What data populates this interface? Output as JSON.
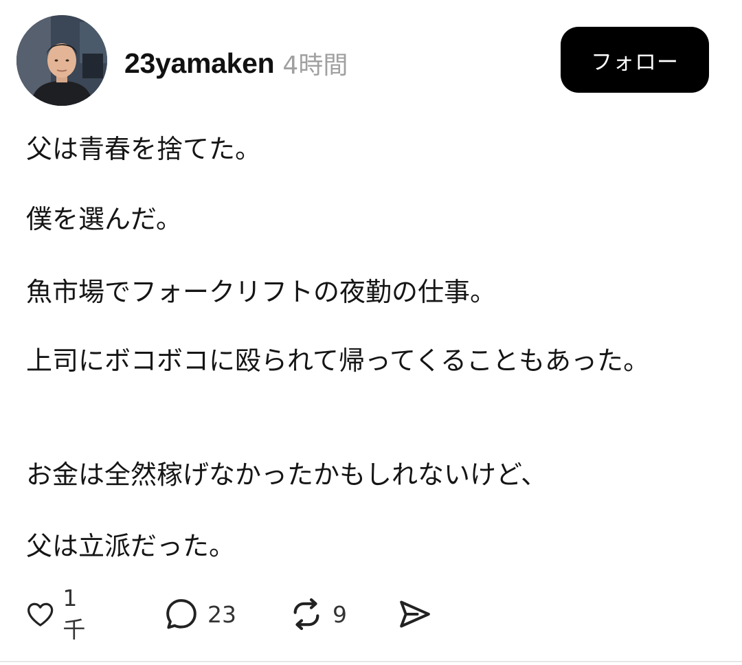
{
  "post": {
    "author": {
      "username": "23yamaken",
      "time_ago": "4時間"
    },
    "follow_label": "フォロー",
    "paragraphs": [
      "父は青春を捨てた。",
      "僕を選んだ。",
      "魚市場でフォークリフトの夜勤の仕事。",
      "上司にボコボコに殴られて帰ってくることもあった。",
      "お金は全然稼げなかったかもしれないけど、",
      "父は立派だった。"
    ],
    "actions": {
      "like": {
        "icon": "heart-icon",
        "count": "1千"
      },
      "reply": {
        "icon": "speech-bubble-icon",
        "count": "23"
      },
      "repost": {
        "icon": "repost-icon",
        "count": "9"
      },
      "share": {
        "icon": "send-icon"
      }
    }
  }
}
